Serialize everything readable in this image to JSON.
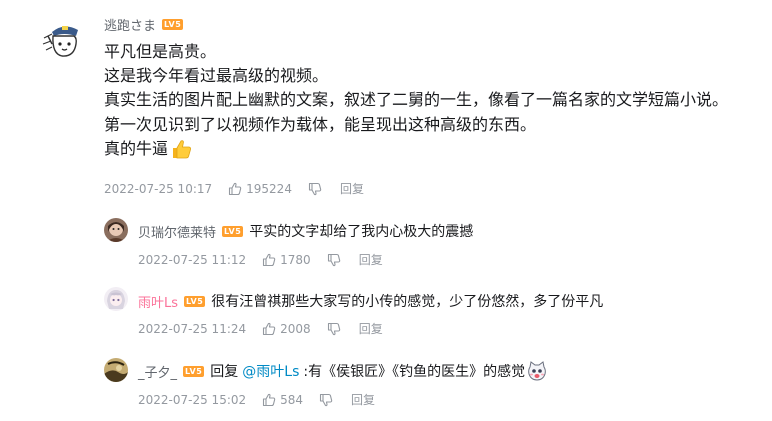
{
  "main_comment": {
    "username": "逃跑さま",
    "level": "LV5",
    "lines": [
      "平凡但是高贵。",
      "这是我今年看过最高级的视频。",
      "真实生活的图片配上幽默的文案，叙述了二舅的一生，像看了一篇名家的文学短篇小说。",
      "第一次见识到了以视频作为载体，能呈现出这种高级的东西。",
      "真的牛逼"
    ],
    "emoji": "thumbs-up-emoji",
    "time": "2022-07-25 10:17",
    "likes": "195224",
    "reply_label": "回复"
  },
  "replies": [
    {
      "username": "贝瑞尔德莱特",
      "level": "LV5",
      "text": "平实的文字却给了我内心极大的震撼",
      "time": "2022-07-25 11:12",
      "likes": "1780",
      "reply_label": "回复"
    },
    {
      "username": "雨叶Ls",
      "level": "LV5",
      "text": "很有汪曾祺那些大家写的小传的感觉，少了份悠然，多了份平凡",
      "time": "2022-07-25 11:24",
      "likes": "2008",
      "reply_label": "回复"
    },
    {
      "username": "_子夕_",
      "level": "LV5",
      "reply_prefix": "回复",
      "mention": "@雨叶Ls",
      "text": ":有《侯银匠》《钓鱼的医生》的感觉",
      "emoji": "cat-face-emoji",
      "time": "2022-07-25 15:02",
      "likes": "584",
      "reply_label": "回复"
    }
  ],
  "colors": {
    "level_badge": "#ff9f2e",
    "mention": "#008ac5",
    "pink_name": "#fb7299",
    "meta": "#9499a0"
  }
}
